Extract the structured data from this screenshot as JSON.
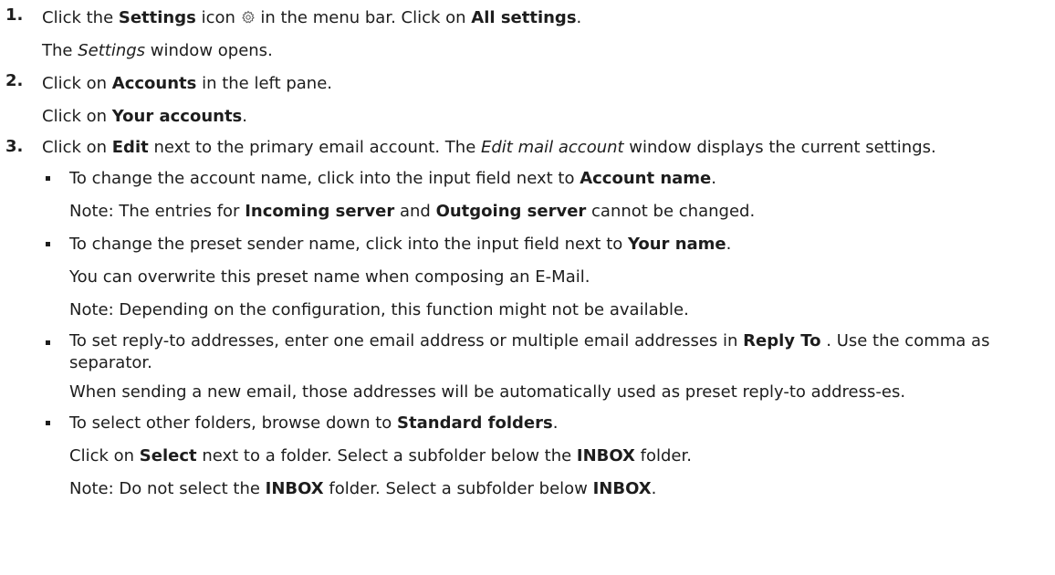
{
  "steps": [
    {
      "number": "1.",
      "line1": {
        "a": "Click the ",
        "b": "Settings",
        "c": " icon ",
        "d": " in the menu bar. Click on ",
        "e": "All settings",
        "f": "."
      },
      "line2": {
        "a": "The ",
        "i": "Settings",
        "c": " window opens."
      }
    },
    {
      "number": "2.",
      "line1": {
        "a": "Click on ",
        "b": "Accounts",
        "c": " in the left pane."
      },
      "line2": {
        "a": "Click on ",
        "b": "Your accounts",
        "c": "."
      }
    },
    {
      "number": "3.",
      "line1": {
        "a": "Click on ",
        "b": "Edit",
        "c": " next to the primary email account. The ",
        "i": "Edit mail account",
        "d": " window displays the current settings."
      }
    }
  ],
  "bullets": [
    {
      "l1": {
        "a": "To change the account name, click into the input field next to ",
        "b": "Account name",
        "c": "."
      },
      "l2": {
        "a": "Note: The entries for ",
        "b": "Incoming server",
        "c": " and ",
        "d": "Outgoing server",
        "e": " cannot be changed."
      }
    },
    {
      "l1": {
        "a": "To change the preset sender name, click into the input field next to ",
        "b": "Your name",
        "c": "."
      },
      "l2": "You can overwrite this preset name when composing an E-Mail.",
      "l3": "Note: Depending on the configuration, this function might not be available."
    },
    {
      "l1": {
        "a": "To set reply-to addresses, enter one email address or multiple email addresses in ",
        "b": "Reply To",
        "c": " . Use the comma as separator."
      },
      "l2": "When sending a new email, those addresses will be automatically used as preset reply-to address-es."
    },
    {
      "l1": {
        "a": "To select other folders, browse down to ",
        "b": "Standard folders",
        "c": "."
      },
      "l2": {
        "a": "Click on ",
        "b": "Select",
        "c": " next to a folder. Select a subfolder below the ",
        "d": "INBOX",
        "e": " folder."
      },
      "l3": {
        "a": "Note: Do not select the ",
        "b": "INBOX",
        "c": " folder. Select a subfolder below ",
        "d": "INBOX",
        "e": "."
      }
    }
  ],
  "icons": {
    "settings": "gear-icon"
  }
}
